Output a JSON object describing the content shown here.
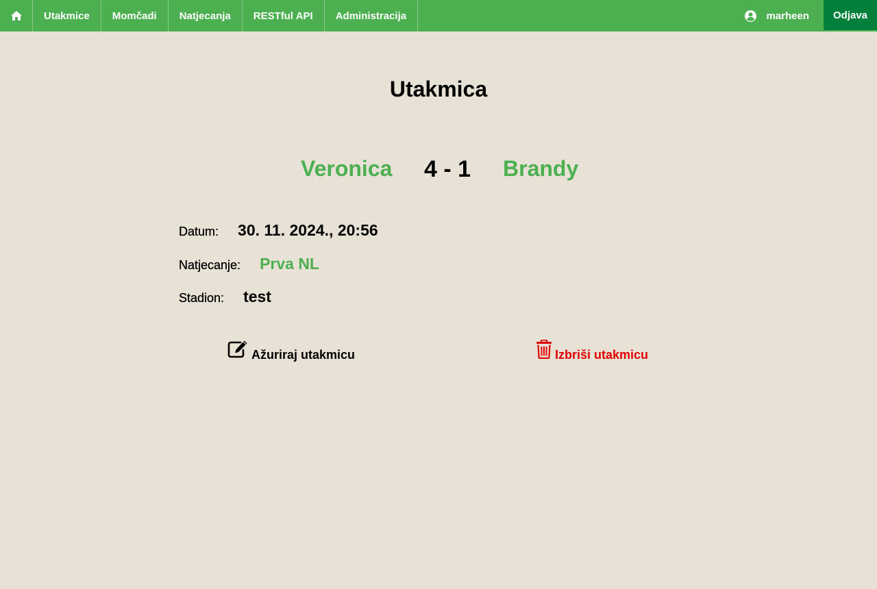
{
  "nav": {
    "home_icon": "home-icon",
    "items": [
      {
        "label": "Utakmice"
      },
      {
        "label": "Momčadi"
      },
      {
        "label": "Natjecanja"
      },
      {
        "label": "RESTful API"
      },
      {
        "label": "Administracija"
      }
    ],
    "user": {
      "icon": "user-circle-icon",
      "name": "marheen"
    },
    "logout_label": "Odjava"
  },
  "page": {
    "title": "Utakmica"
  },
  "match": {
    "home_team": "Veronica",
    "score": "4 - 1",
    "away_team": "Brandy"
  },
  "details": {
    "date_label": "Datum:",
    "date_value": "30. 11. 2024., 20:56",
    "competition_label": "Natjecanje:",
    "competition_value": "Prva NL",
    "stadium_label": "Stadion:",
    "stadium_value": "test"
  },
  "actions": {
    "update": {
      "label": "Ažuriraj utakmicu",
      "icon": "edit-icon"
    },
    "delete": {
      "label": "Izbriši utakmicu",
      "icon": "trash-icon"
    }
  },
  "colors": {
    "nav_bg": "#4caf50",
    "logout_bg": "#00803a",
    "page_bg": "#e8e2d6",
    "accent_green": "#4caf50",
    "danger_red": "#e00000"
  }
}
